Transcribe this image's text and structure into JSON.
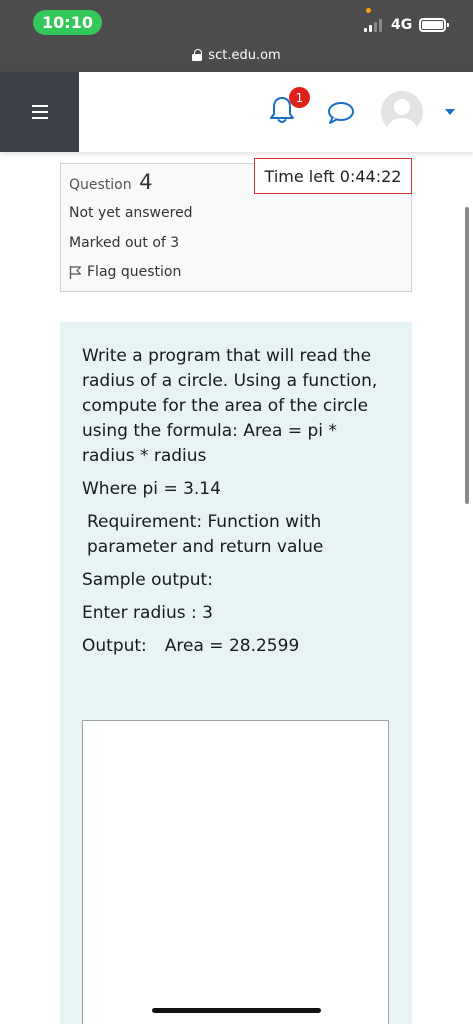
{
  "status_bar": {
    "time": "10:10",
    "network": "4G",
    "clock_color": "#34c759"
  },
  "address_bar": {
    "url": "sct.edu.om"
  },
  "navbar": {
    "notification_count": "1",
    "accent": "#1a6fc5",
    "badge_color": "#e0201a"
  },
  "question_info": {
    "label": "Question",
    "number": "4",
    "state": "Not yet answered",
    "grade": "Marked out of 3",
    "flag_label": "Flag question"
  },
  "timer": {
    "text": "Time left 0:44:22"
  },
  "question_text": {
    "prompt": "Write a program that will read the radius of a circle. Using a function, compute for the area of the circle using the formula: Area = pi * radius * radius",
    "pi_line": "Where pi = 3.14",
    "requirement": "Requirement: Function with parameter and return value",
    "sample_heading": "Sample output:",
    "sample_input": "Enter radius : 3",
    "sample_output_label": "Output:",
    "sample_output_value": "Area = 28.2599"
  },
  "icons": {
    "menu": "hamburger-icon",
    "notifications": "bell-icon",
    "messages": "chat-bubble-icon",
    "user": "avatar",
    "flag": "flag-icon",
    "secure": "lock-icon"
  }
}
